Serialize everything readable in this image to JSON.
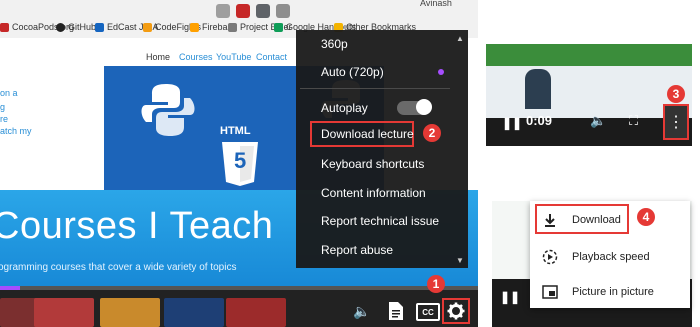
{
  "left_panel": {
    "browser": {
      "user": "Avinash",
      "bookmarks": [
        "CocoaPods.org",
        "GitHub",
        "EdCast JIRA",
        "CodeFights",
        "Firebase",
        "Project Euler",
        "Google Hangouts",
        "Other Bookmarks"
      ]
    },
    "site": {
      "nav": [
        "Home",
        "Courses",
        "YouTube",
        "Contact"
      ],
      "side_text": [
        "on a",
        "g",
        "re",
        "atch my"
      ],
      "html_badge": "HTML",
      "html_number": "5",
      "title": "Courses I Teach",
      "subtitle": "ogramming courses that cover a wide variety of topics"
    },
    "settings_menu": {
      "items": [
        "360p",
        "Auto (720p)",
        "Autoplay",
        "Download lecture",
        "Keyboard shortcuts",
        "Content information",
        "Report technical issue",
        "Report abuse"
      ],
      "autoplay_on": true
    },
    "controls": {
      "cc_label": "CC",
      "volume_icon": "volume-icon",
      "transcript_icon": "transcript-icon",
      "settings_icon": "gear-icon"
    },
    "badges": {
      "one": "1",
      "two": "2"
    }
  },
  "right_top_panel": {
    "time": "0:09",
    "badge": "3"
  },
  "right_bottom_panel": {
    "items": [
      "Download",
      "Playback speed",
      "Picture in picture"
    ],
    "badge": "4"
  },
  "colors": {
    "annotation_red": "#e53935",
    "accent_purple": "#a64dff",
    "banner_blue": "#2ba6e8"
  }
}
